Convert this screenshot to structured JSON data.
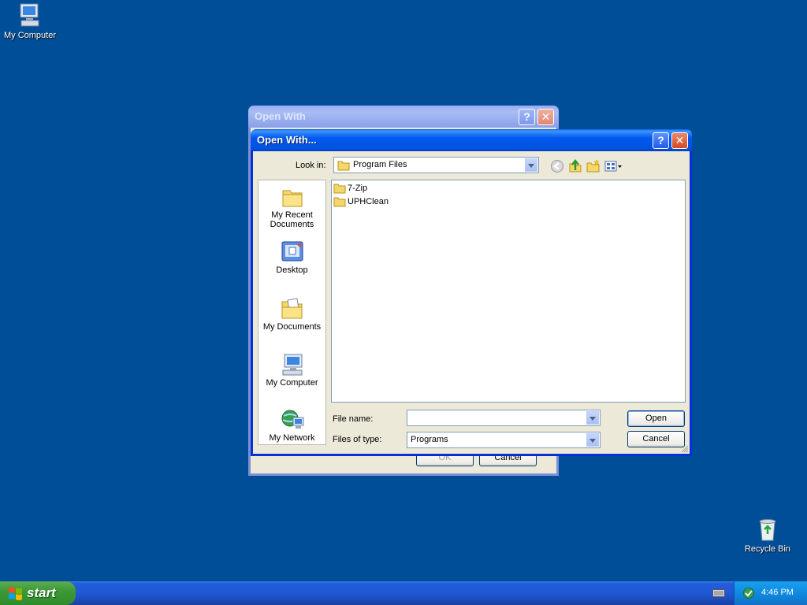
{
  "desktop": {
    "icons": [
      {
        "label": "My Computer"
      },
      {
        "label": "Recycle Bin"
      }
    ]
  },
  "background_window": {
    "title": "Open With",
    "help_symbol": "?",
    "close_symbol": "✕",
    "ok_label": "OK",
    "cancel_label": "Cancel"
  },
  "dialog": {
    "title": "Open With...",
    "help_symbol": "?",
    "close_symbol": "✕",
    "look_in_label": "Look in:",
    "look_in_value": "Program Files",
    "places": [
      {
        "label": "My Recent Documents"
      },
      {
        "label": "Desktop"
      },
      {
        "label": "My Documents"
      },
      {
        "label": "My Computer"
      },
      {
        "label": "My Network"
      }
    ],
    "files": [
      {
        "name": "7-Zip"
      },
      {
        "name": "UPHClean"
      }
    ],
    "file_name_label": "File name:",
    "file_name_value": "",
    "files_of_type_label": "Files of type:",
    "files_of_type_value": "Programs",
    "open_label": "Open",
    "cancel_label": "Cancel"
  },
  "taskbar": {
    "start_label": "start",
    "clock": "4:46 PM"
  },
  "colors": {
    "desktop": "#004e98",
    "title_active": "#0058ee",
    "dialog_face": "#ece9d8",
    "start_green": "#3c9a35"
  }
}
